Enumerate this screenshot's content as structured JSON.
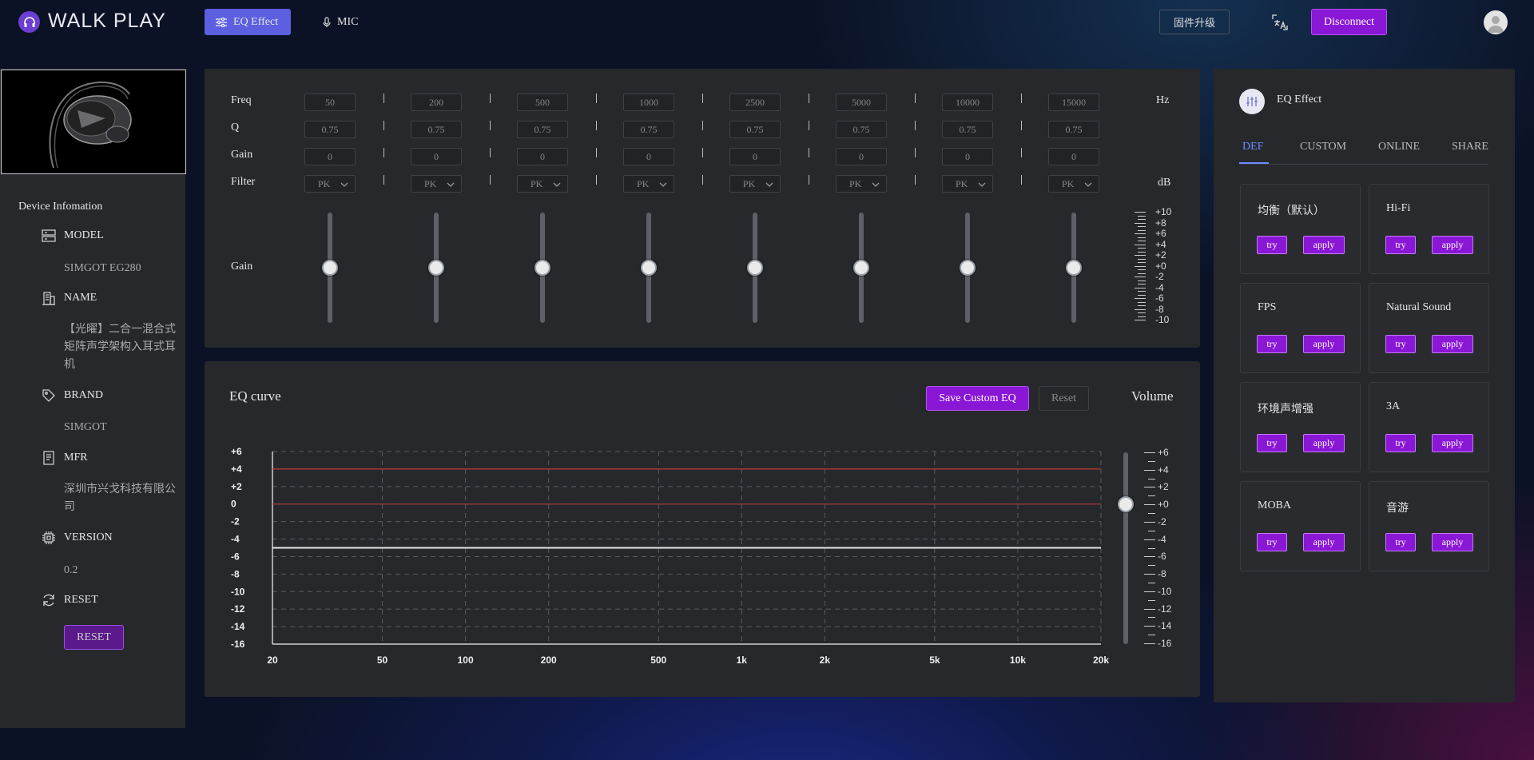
{
  "header": {
    "logo_text": "WALK PLAY",
    "tabs": [
      {
        "label": "EQ Effect",
        "active": true
      },
      {
        "label": "MIC",
        "active": false
      }
    ],
    "firmware_label": "固件升级",
    "disconnect_label": "Disconnect"
  },
  "device": {
    "section_title": "Device Infomation",
    "fields": [
      {
        "label": "MODEL",
        "value": "SIMGOT EG280"
      },
      {
        "label": "NAME",
        "value": "【光曜】二合一混合式矩阵声学架构入耳式耳机"
      },
      {
        "label": "BRAND",
        "value": "SIMGOT"
      },
      {
        "label": "MFR",
        "value": "深圳市兴戈科技有限公司"
      },
      {
        "label": "VERSION",
        "value": "0.2"
      },
      {
        "label": "RESET",
        "value": ""
      }
    ],
    "reset_button": "RESET"
  },
  "eq_params": {
    "labels": {
      "freq": "Freq",
      "q": "Q",
      "gain": "Gain",
      "filter": "Filter",
      "gain_slider": "Gain",
      "hz": "Hz",
      "db": "dB"
    },
    "bands": [
      {
        "freq": "50",
        "q": "0.75",
        "gain": "0",
        "filter": "PK",
        "slider_gain": 0
      },
      {
        "freq": "200",
        "q": "0.75",
        "gain": "0",
        "filter": "PK",
        "slider_gain": 0
      },
      {
        "freq": "500",
        "q": "0.75",
        "gain": "0",
        "filter": "PK",
        "slider_gain": 0
      },
      {
        "freq": "1000",
        "q": "0.75",
        "gain": "0",
        "filter": "PK",
        "slider_gain": 0
      },
      {
        "freq": "2500",
        "q": "0.75",
        "gain": "0",
        "filter": "PK",
        "slider_gain": 0
      },
      {
        "freq": "5000",
        "q": "0.75",
        "gain": "0",
        "filter": "PK",
        "slider_gain": 0
      },
      {
        "freq": "10000",
        "q": "0.75",
        "gain": "0",
        "filter": "PK",
        "slider_gain": 0
      },
      {
        "freq": "15000",
        "q": "0.75",
        "gain": "0",
        "filter": "PK",
        "slider_gain": 0
      }
    ],
    "gain_scale": [
      "+10",
      "+8",
      "+6",
      "+4",
      "+2",
      "+0",
      "-2",
      "-4",
      "-6",
      "-8",
      "-10"
    ]
  },
  "eq_curve": {
    "title": "EQ curve",
    "save_label": "Save Custom EQ",
    "reset_label": "Reset",
    "volume_label": "Volume",
    "volume_value": 0,
    "volume_scale": [
      "+6",
      "+4",
      "+2",
      "+0",
      "-2",
      "-4",
      "-6",
      "-8",
      "-10",
      "-12",
      "-14",
      "-16"
    ]
  },
  "chart_data": {
    "type": "line",
    "title": "EQ curve",
    "xlabel": "",
    "ylabel": "",
    "x_scale": "log",
    "xlim": [
      20,
      20000
    ],
    "ylim": [
      -16,
      6
    ],
    "x_ticks": [
      {
        "value": 20,
        "label": "20"
      },
      {
        "value": 50,
        "label": "50"
      },
      {
        "value": 100,
        "label": "100"
      },
      {
        "value": 200,
        "label": "200"
      },
      {
        "value": 500,
        "label": "500"
      },
      {
        "value": 1000,
        "label": "1k"
      },
      {
        "value": 2000,
        "label": "2k"
      },
      {
        "value": 5000,
        "label": "5k"
      },
      {
        "value": 10000,
        "label": "10k"
      },
      {
        "value": 20000,
        "label": "20k"
      }
    ],
    "y_ticks": [
      {
        "value": 6,
        "label": "+6"
      },
      {
        "value": 4,
        "label": "+4"
      },
      {
        "value": 2,
        "label": "+2"
      },
      {
        "value": 0,
        "label": "0"
      },
      {
        "value": -2,
        "label": "-2"
      },
      {
        "value": -4,
        "label": "-4"
      },
      {
        "value": -6,
        "label": "-6"
      },
      {
        "value": -8,
        "label": "-8"
      },
      {
        "value": -10,
        "label": "-10"
      },
      {
        "value": -12,
        "label": "-12"
      },
      {
        "value": -14,
        "label": "-14"
      },
      {
        "value": -16,
        "label": "-16"
      }
    ],
    "grid": true,
    "series": [
      {
        "x": [
          20,
          20000
        ],
        "y": [
          4,
          4
        ],
        "color": "#c0392b"
      },
      {
        "x": [
          20,
          20000
        ],
        "y": [
          0,
          0
        ],
        "color": "#a33a3a"
      },
      {
        "x": [
          20,
          20000
        ],
        "y": [
          -5,
          -5
        ],
        "color": "#e8e8e8"
      }
    ]
  },
  "presets": {
    "header_title": "EQ Effect",
    "tabs": [
      {
        "label": "DEF",
        "active": true
      },
      {
        "label": "CUSTOM",
        "active": false
      },
      {
        "label": "ONLINE",
        "active": false
      },
      {
        "label": "SHARE",
        "active": false
      }
    ],
    "try_label": "try",
    "apply_label": "apply",
    "items": [
      {
        "name": "均衡（默认）"
      },
      {
        "name": "Hi-Fi"
      },
      {
        "name": "FPS"
      },
      {
        "name": "Natural Sound"
      },
      {
        "name": "环境声增强"
      },
      {
        "name": "3A"
      },
      {
        "name": "MOBA"
      },
      {
        "name": "音游"
      }
    ]
  },
  "colors": {
    "accent_purple": "#8a17d6",
    "nav_active": "#5b5fe0",
    "tab_active": "#6b8cff",
    "panel_bg": "#27282c"
  }
}
